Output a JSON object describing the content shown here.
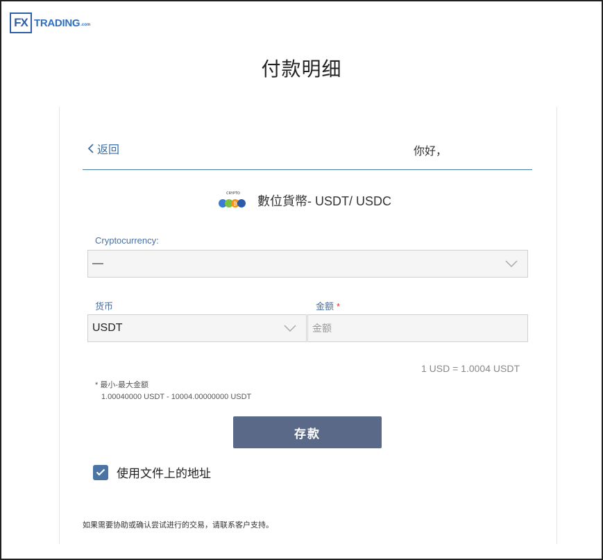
{
  "logo": {
    "mark": "FX",
    "text": "TRADING",
    "suffix": ".com"
  },
  "page_title": "付款明细",
  "header": {
    "back_label": "返回",
    "greeting": "你好，"
  },
  "payment_method": {
    "icon": "crypto-coins-icon",
    "label": "數位貨幣- USDT/ USDC"
  },
  "form": {
    "crypto_label": "Cryptocurrency:",
    "crypto_value": "—",
    "currency_label": "货币",
    "currency_value": "USDT",
    "amount_label": "金额",
    "amount_required": "*",
    "amount_placeholder": "金额",
    "rate": "1 USD = 1.0004 USDT",
    "minmax_label": "* 最小-最大金额",
    "minmax_value": "1.00040000 USDT - 10004.00000000 USDT",
    "submit_label": "存款",
    "use_address_label": "使用文件上的地址",
    "use_address_checked": true
  },
  "footer_note": "如果需要协助或确认尝试进行的交易，请联系客户支持。",
  "colors": {
    "accent": "#4a74a4",
    "button": "#5a6987",
    "link": "#3d6ea3",
    "required": "#d9342b"
  }
}
